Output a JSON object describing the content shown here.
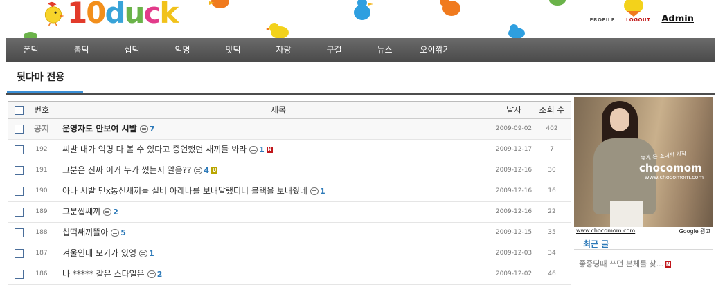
{
  "site": {
    "logo_text": "10duck"
  },
  "header": {
    "profile_label": "PROFILE",
    "logout_label": "LOGOUT",
    "user_label": "Admin"
  },
  "nav": {
    "items": [
      "폰덕",
      "뽐덕",
      "십덕",
      "익명",
      "맛덕",
      "자랑",
      "구걸",
      "뉴스",
      "오이깎기"
    ]
  },
  "board": {
    "tab_label": "뒷다마 전용"
  },
  "list": {
    "headers": {
      "num": "번호",
      "title": "제목",
      "date": "날자",
      "views": "조회 수"
    },
    "rows": [
      {
        "num": "공지",
        "title": "운영자도 안보여 시발",
        "comments": "7",
        "badge": "",
        "date": "2009-09-02",
        "views": "402"
      },
      {
        "num": "192",
        "title": "씨발 내가 익명 다 볼 수 있다고 증언했던 새끼들 봐라",
        "comments": "1",
        "badge": "N",
        "date": "2009-12-17",
        "views": "7"
      },
      {
        "num": "191",
        "title": "그분은 진짜 이거 누가 썼는지 알음??",
        "comments": "4",
        "badge": "U",
        "date": "2009-12-16",
        "views": "30"
      },
      {
        "num": "190",
        "title": "아나 시발 민x통신새끼들 실버 아레나를 보내달랬더니 블랙을 보내줬네",
        "comments": "1",
        "badge": "",
        "date": "2009-12-16",
        "views": "16"
      },
      {
        "num": "189",
        "title": "그분씹쌔끼",
        "comments": "2",
        "badge": "",
        "date": "2009-12-16",
        "views": "22"
      },
      {
        "num": "188",
        "title": "십떡쌔끼뜰아",
        "comments": "5",
        "badge": "",
        "date": "2009-12-15",
        "views": "35"
      },
      {
        "num": "187",
        "title": "겨울인데 모기가 있엉",
        "comments": "1",
        "badge": "",
        "date": "2009-12-03",
        "views": "34"
      },
      {
        "num": "186",
        "title": "나 ***** 같은 스타일은",
        "comments": "2",
        "badge": "",
        "date": "2009-12-02",
        "views": "46"
      }
    ]
  },
  "ad": {
    "tagline": "늦게 온 소녀의 시작",
    "brand": "chocomom",
    "url_text": "www.chocomom.com",
    "footer_link": "www.chocomom.com",
    "footer_label": "Google 광고"
  },
  "recent": {
    "title": "최근 글",
    "items": [
      {
        "text": "좋중딩때 쓰던 본체를 찾...",
        "badge": "N"
      }
    ]
  },
  "colors": {
    "nav_bg": "#555555",
    "accent": "#2c79b8",
    "new_badge": "#c0161b"
  }
}
